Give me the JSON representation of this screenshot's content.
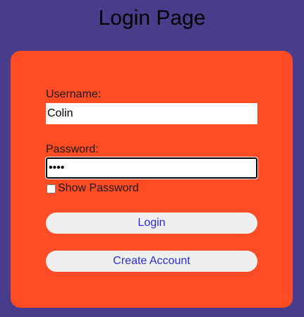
{
  "page": {
    "title": "Login Page"
  },
  "form": {
    "username_label": "Username:",
    "username_value": "Colin",
    "password_label": "Password:",
    "password_value": "abcd",
    "show_password_label": "Show Password",
    "show_password_checked": false,
    "login_label": "Login",
    "create_account_label": "Create Account"
  },
  "colors": {
    "background": "#483D8B",
    "card": "#FF4C24",
    "button_bg": "#EFEFEF",
    "button_text": "#2B2BD9"
  }
}
